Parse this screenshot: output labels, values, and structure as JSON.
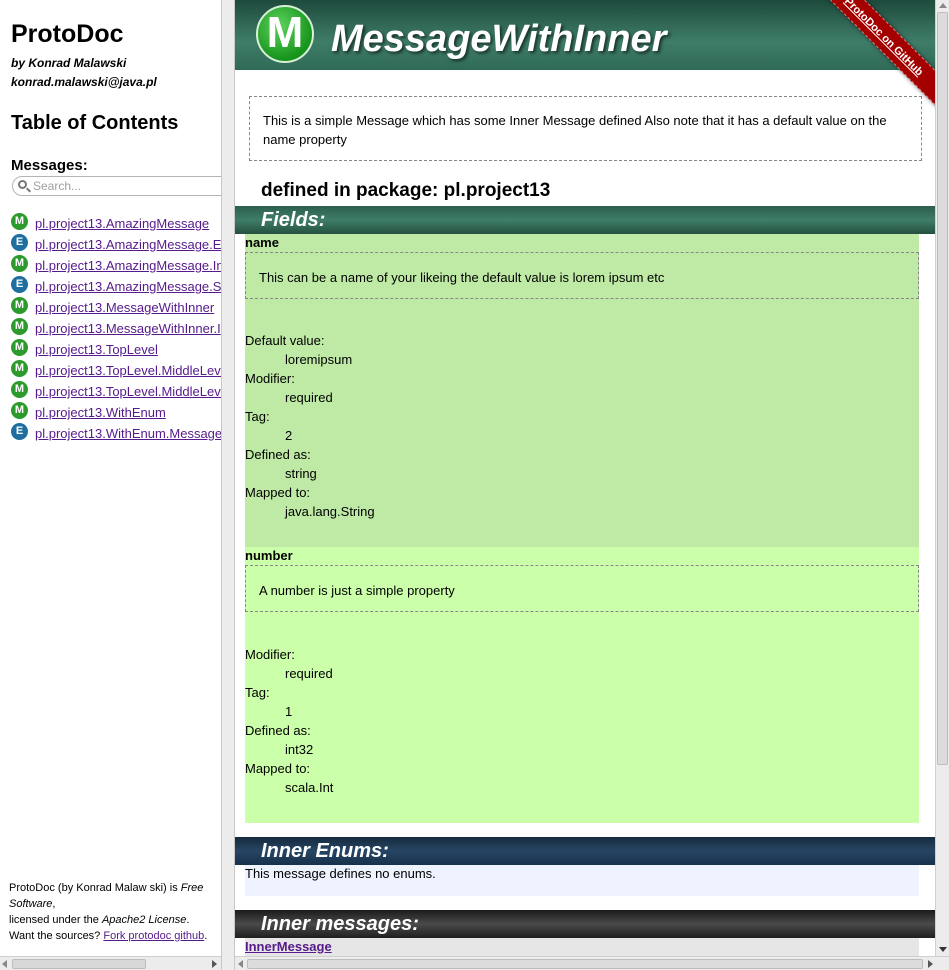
{
  "sidebar": {
    "title": "ProtoDoc",
    "author": "by Konrad Malawski",
    "email": "konrad.malawski@java.pl",
    "toc_title": "Table of Contents",
    "messages_label": "Messages:",
    "search_placeholder": "Search...",
    "items": [
      {
        "badge": "M",
        "label": "pl.project13.AmazingMessage"
      },
      {
        "badge": "E",
        "label": "pl.project13.AmazingMessage.E"
      },
      {
        "badge": "M",
        "label": "pl.project13.AmazingMessage.In"
      },
      {
        "badge": "E",
        "label": "pl.project13.AmazingMessage.S"
      },
      {
        "badge": "M",
        "label": "pl.project13.MessageWithInner"
      },
      {
        "badge": "M",
        "label": "pl.project13.MessageWithInner.I"
      },
      {
        "badge": "M",
        "label": "pl.project13.TopLevel"
      },
      {
        "badge": "M",
        "label": "pl.project13.TopLevel.MiddleLeve"
      },
      {
        "badge": "M",
        "label": "pl.project13.TopLevel.MiddleLeve"
      },
      {
        "badge": "M",
        "label": "pl.project13.WithEnum"
      },
      {
        "badge": "E",
        "label": "pl.project13.WithEnum.Message"
      }
    ],
    "footer": {
      "line1_a": "ProtoDoc (by Konrad Malaw ski) is ",
      "line1_b": "Free Software",
      "line1_c": ",",
      "line2_a": "licensed under the ",
      "line2_b": "Apache2 License",
      "line2_c": ".",
      "line3_a": "Want the sources? ",
      "line3_link": "Fork protodoc github",
      "line3_c": "."
    }
  },
  "main": {
    "logo_letter": "M",
    "title": "MessageWithInner",
    "ribbon": "ProtoDoc on GitHub",
    "description": "This is a simple Message which has some Inner Message defined Also note that it has a default value on the name property",
    "package_line": "defined in package: pl.project13",
    "fields_title": "Fields:",
    "fields": [
      {
        "name": "name",
        "description": "This can be a name of your likeing the default value is lorem ipsum etc",
        "props": [
          {
            "label": "Default value:",
            "value": "loremipsum"
          },
          {
            "label": "Modifier:",
            "value": "required"
          },
          {
            "label": "Tag:",
            "value": "2"
          },
          {
            "label": "Defined as:",
            "value": "string"
          },
          {
            "label": "Mapped to:",
            "value": "java.lang.String"
          }
        ]
      },
      {
        "name": "number",
        "description": "A number is just a simple property",
        "props": [
          {
            "label": "Modifier:",
            "value": "required"
          },
          {
            "label": "Tag:",
            "value": "1"
          },
          {
            "label": "Defined as:",
            "value": "int32"
          },
          {
            "label": "Mapped to:",
            "value": "scala.Int"
          }
        ]
      }
    ],
    "enums_title": "Inner Enums:",
    "enums_text": "This message defines no enums.",
    "inner_title": "Inner messages:",
    "inner_link": "InnerMessage"
  },
  "colors": {
    "header_green": "#2f6a56",
    "field_name_bg": "#bfeaa6",
    "field_number_bg": "#ccffaa",
    "ribbon_red": "#a40000",
    "link_visited": "#551a8b"
  }
}
